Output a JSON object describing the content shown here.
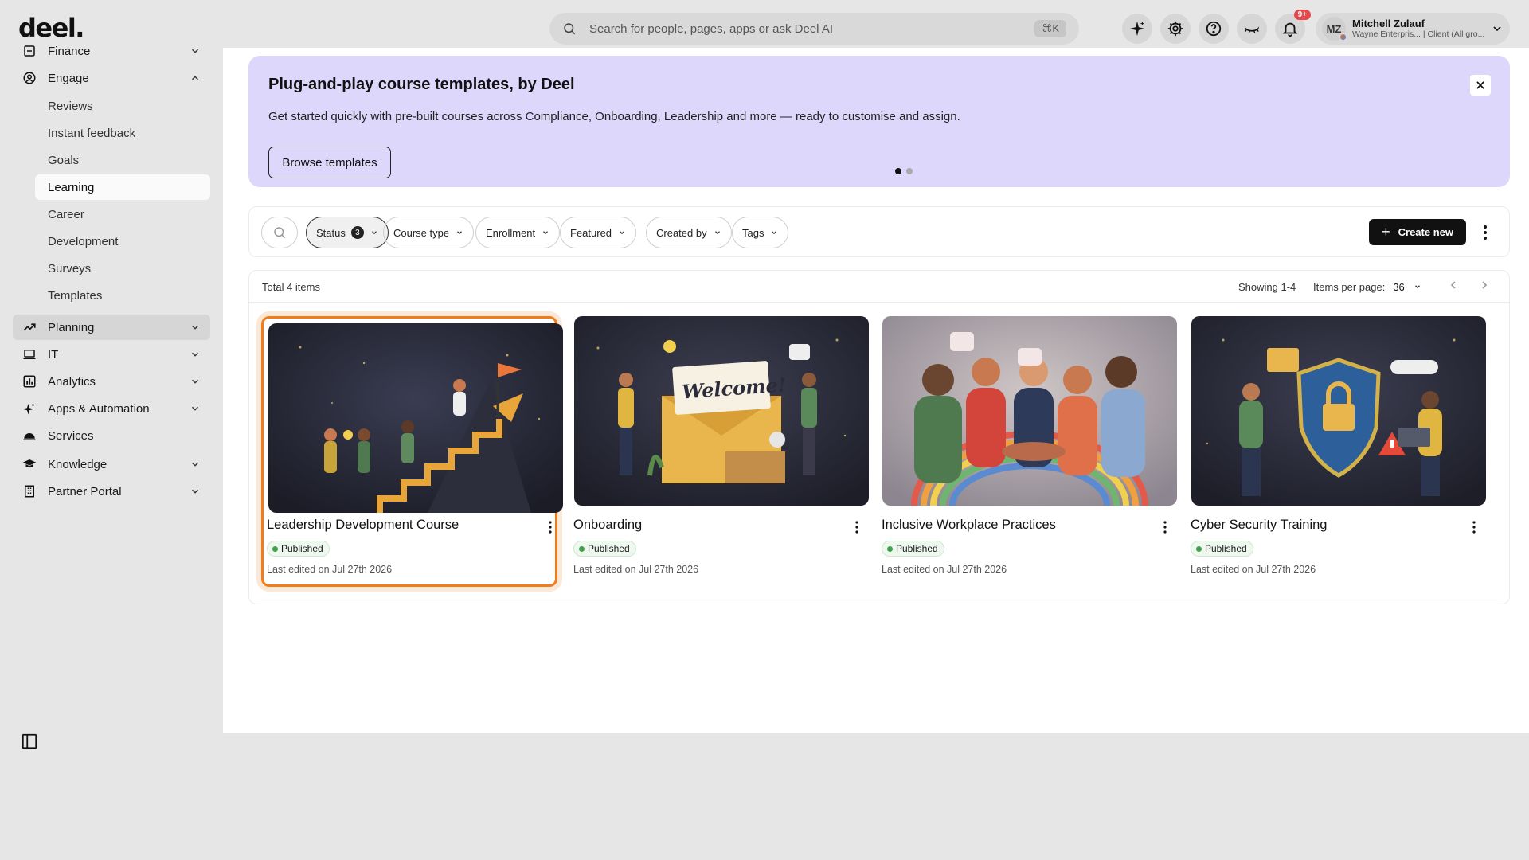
{
  "brand": {
    "logo": "deel."
  },
  "topbar": {
    "search_placeholder": "Search for people, pages, apps or ask Deel AI",
    "search_shortcut": "⌘K",
    "notifications_badge": "9+",
    "user": {
      "initials": "MZ",
      "name": "Mitchell Zulauf",
      "org": "Wayne Enterpris... | Client (All gro..."
    }
  },
  "sidebar": {
    "items": [
      {
        "label": "Finance",
        "icon": "finance-icon"
      },
      {
        "label": "Engage",
        "icon": "engage-icon"
      },
      {
        "label": "Planning",
        "icon": "planning-icon"
      },
      {
        "label": "IT",
        "icon": "laptop-icon"
      },
      {
        "label": "Analytics",
        "icon": "bar-chart-icon"
      },
      {
        "label": "Apps & Automation",
        "icon": "sparkle-icon"
      },
      {
        "label": "Services",
        "icon": "services-icon"
      },
      {
        "label": "Knowledge",
        "icon": "graduation-cap-icon"
      },
      {
        "label": "Partner Portal",
        "icon": "building-icon"
      }
    ],
    "engage_sub": [
      "Reviews",
      "Instant feedback",
      "Goals",
      "Learning",
      "Career",
      "Development",
      "Surveys",
      "Templates"
    ],
    "selected": "Learning"
  },
  "banner": {
    "title": "Plug-and-play course templates, by Deel",
    "description": "Get started quickly with pre-built courses across Compliance, Onboarding, Leadership and more — ready to customise and assign.",
    "button": "Browse templates"
  },
  "filters": {
    "status_label": "Status",
    "status_count": "3",
    "chips": [
      "Course type",
      "Enrollment",
      "Featured",
      "Created by",
      "Tags"
    ],
    "create_label": "Create new"
  },
  "results": {
    "total": "Total 4 items",
    "showing": "Showing 1-4",
    "per_page_label": "Items per page:",
    "per_page_value": "36"
  },
  "courses": [
    {
      "title": "Leadership Development Course",
      "status": "Published",
      "edited": "Last edited on Jul 27th 2026"
    },
    {
      "title": "Onboarding",
      "status": "Published",
      "edited": "Last edited on Jul 27th 2026",
      "image_text": "Welcome!"
    },
    {
      "title": "Inclusive Workplace Practices",
      "status": "Published",
      "edited": "Last edited on Jul 27th 2026"
    },
    {
      "title": "Cyber Security Training",
      "status": "Published",
      "edited": "Last edited on Jul 27th 2026"
    }
  ],
  "colors": {
    "banner_bg": "#ddd8fb",
    "highlight": "#f07d1a",
    "published": "#3fa34d",
    "primary_button": "#111111"
  }
}
